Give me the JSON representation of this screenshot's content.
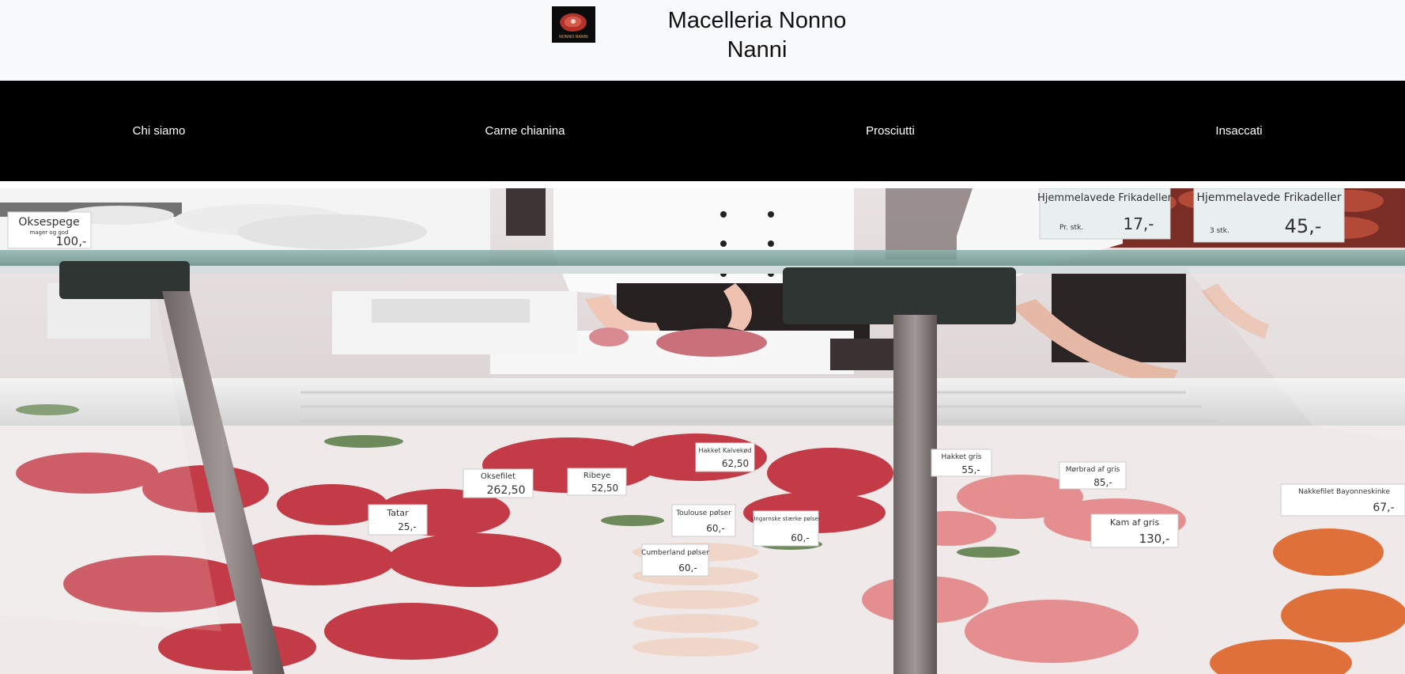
{
  "header": {
    "title": "Macelleria Nonno Nanni",
    "logo_text": "NONNO NANNI"
  },
  "nav": {
    "items": [
      {
        "label": "Chi siamo"
      },
      {
        "label": "Carne chianina"
      },
      {
        "label": "Prosciutti"
      },
      {
        "label": "Insaccati"
      }
    ]
  },
  "hero": {
    "signs": {
      "oksespege": {
        "name": "Oksespege",
        "sub": "mager og god",
        "price": "100,-"
      },
      "frikadeller1": {
        "name": "Hjemmelavede Frikadeller",
        "sub": "Pr. stk.",
        "price": "17,-"
      },
      "frikadeller2": {
        "name": "Hjemmelavede Frikadeller",
        "sub": "3 stk.",
        "price": "45,-"
      },
      "okseflet": {
        "name": "Oksefilet",
        "price": "262,50"
      },
      "ribeye": {
        "name": "Ribeye",
        "price": "52,50"
      },
      "kalvekoed": {
        "name": "Hakket Kalvekød",
        "price": "62,50"
      },
      "toulouse": {
        "name": "Toulouse pølser",
        "price": "60,-"
      },
      "ungarnske": {
        "name": "Ungarnske stærke pølser",
        "price": "60,-"
      },
      "cumberland": {
        "name": "Cumberland pølser",
        "price": "60,-"
      },
      "hakketgris": {
        "name": "Hakket gris",
        "price": "55,-"
      },
      "mørbrad": {
        "name": "Mørbrad af gris",
        "price": "85,-"
      },
      "kamafgris": {
        "name": "Kam af gris",
        "price": "130,-"
      },
      "tatar": {
        "name": "Tatar",
        "price": "25,-"
      },
      "bayonneskinke": {
        "name": "Nakkefilet Bayonneskinke",
        "price": "67,-"
      }
    }
  },
  "colors": {
    "header_bg": "#f8f9fa",
    "nav_bg": "#000000",
    "nav_text": "#ffffff",
    "title_text": "#111111"
  }
}
